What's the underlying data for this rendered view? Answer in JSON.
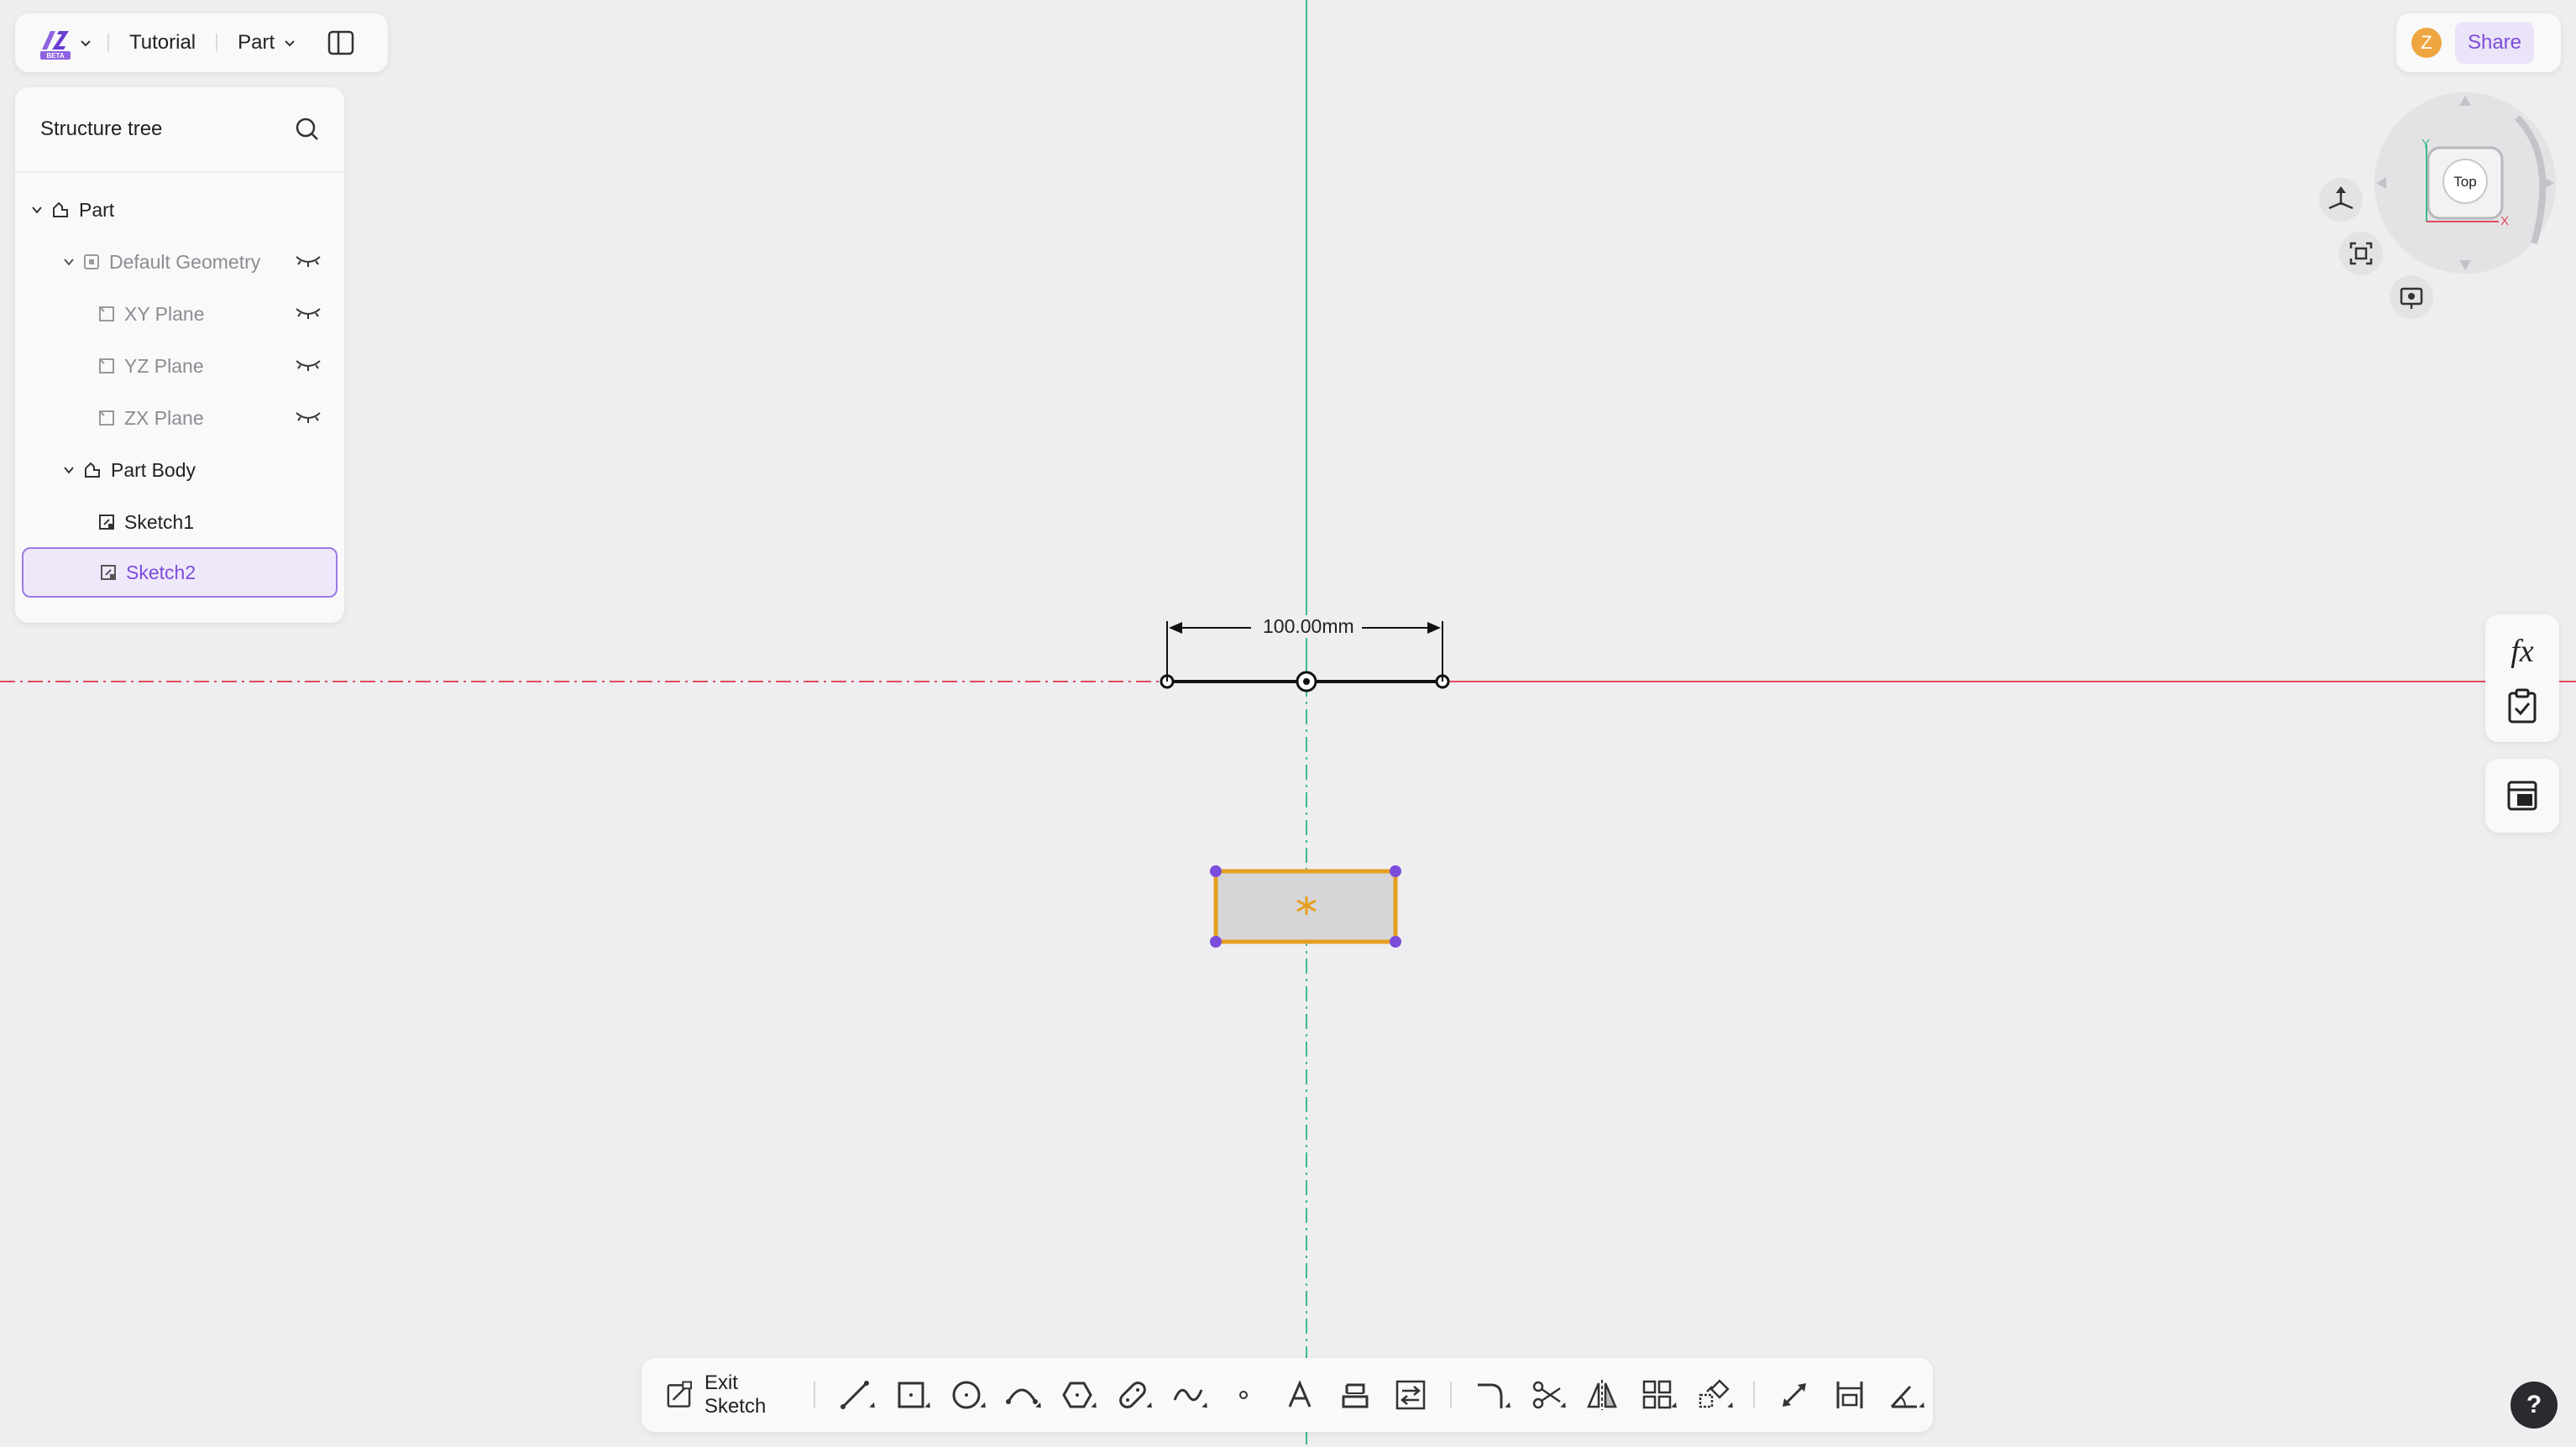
{
  "header": {
    "logo_sub": "BETA",
    "breadcrumb": "Tutorial",
    "part_menu": "Part"
  },
  "tree": {
    "title": "Structure tree",
    "items": [
      {
        "label": "Part"
      },
      {
        "label": "Default Geometry"
      },
      {
        "label": "XY Plane"
      },
      {
        "label": "YZ Plane"
      },
      {
        "label": "ZX Plane"
      },
      {
        "label": "Part Body"
      },
      {
        "label": "Sketch1"
      },
      {
        "label": "Sketch2"
      }
    ]
  },
  "topright": {
    "avatar_letter": "Z",
    "share_label": "Share"
  },
  "viewcube": {
    "face_label": "Top",
    "axis_y": "Y",
    "axis_x": "X"
  },
  "sketch": {
    "dimension_label": "100.00mm"
  },
  "toolbar": {
    "exit_label": "Exit Sketch"
  },
  "right_rail": {
    "formula_label": "fx"
  },
  "help_label": "?",
  "colors": {
    "accent": "#7c4ddb",
    "x_axis": "#e04a5f",
    "y_axis": "#3fb98c",
    "selection": "#e6a020",
    "vertex": "#7c4ddb"
  }
}
